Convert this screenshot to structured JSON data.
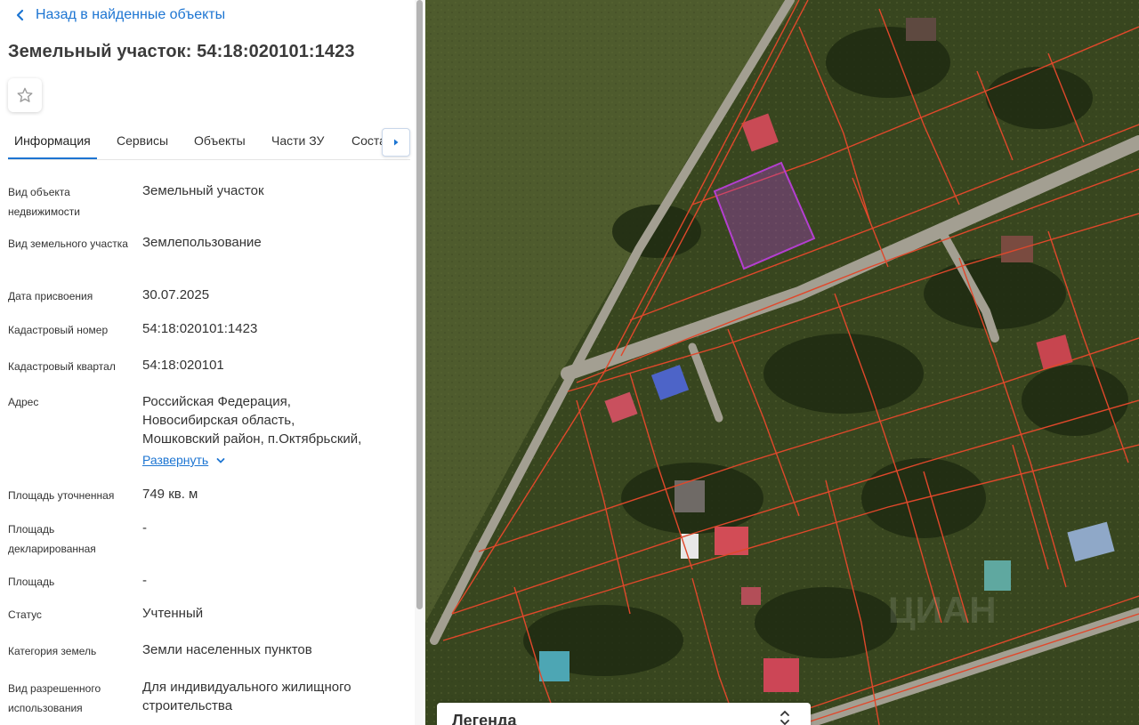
{
  "nav": {
    "back_label": "Назад в найденные объекты"
  },
  "header": {
    "title": "Земельный участок: 54:18:020101:1423"
  },
  "tabs": [
    {
      "label": "Информация",
      "active": true
    },
    {
      "label": "Сервисы"
    },
    {
      "label": "Объекты"
    },
    {
      "label": "Части ЗУ"
    },
    {
      "label": "Состав"
    }
  ],
  "properties": {
    "object_type": {
      "label": "Вид объекта недвижимости",
      "value": "Земельный участок"
    },
    "parcel_type": {
      "label": "Вид земельного участка",
      "value": "Землепользование"
    },
    "assigned_date": {
      "label": "Дата присвоения",
      "value": "30.07.2025"
    },
    "cadastral_number": {
      "label": "Кадастровый номер",
      "value": "54:18:020101:1423"
    },
    "cadastral_block": {
      "label": "Кадастровый квартал",
      "value": "54:18:020101"
    },
    "address": {
      "label": "Адрес",
      "lines": [
        "Российская Федерация,",
        "Новосибирская область,",
        "Мошковский район, п.Октябрьский,"
      ],
      "expand_label": "Развернуть"
    },
    "area_specified": {
      "label": "Площадь уточненная",
      "value": "749 кв. м"
    },
    "area_declared": {
      "label": "Площадь декларированная",
      "value": "-"
    },
    "area": {
      "label": "Площадь",
      "value": "-"
    },
    "status": {
      "label": "Статус",
      "value": "Учтенный"
    },
    "land_category": {
      "label": "Категория земель",
      "value": "Земли населенных пунктов"
    },
    "permitted_use": {
      "label": "Вид разрешенного использования",
      "value": "Для индивидуального жилищного строительства"
    }
  },
  "map": {
    "legend_title": "Легенда",
    "watermark": "ЦИАН",
    "colors": {
      "parcel_border": "#e0482b",
      "selected_parcel": "#b43fd0",
      "meadow": "#4d5a2c",
      "plots": "#3a4a22",
      "road": "#a29e92"
    }
  },
  "colors": {
    "accent": "#1d75d2",
    "text": "#333333"
  }
}
